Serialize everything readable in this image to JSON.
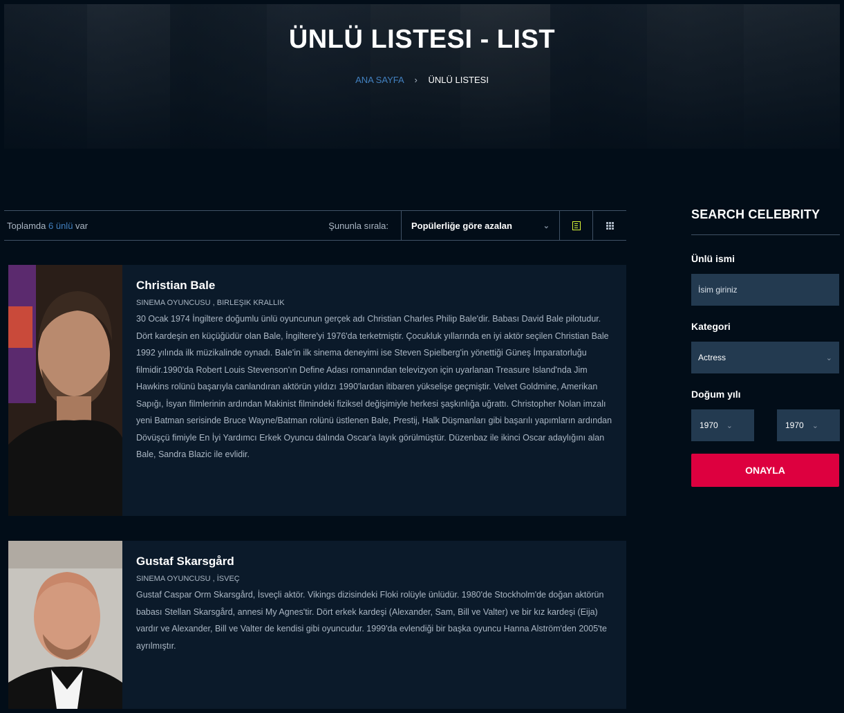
{
  "hero": {
    "title": "ÜNLÜ LISTESI - LIST",
    "breadcrumb": {
      "home": "ANA SAYFA",
      "separator": "›",
      "current": "ÜNLÜ LISTESI"
    }
  },
  "toolbar": {
    "total_prefix": "Toplamda",
    "total_count": "6 ünlü",
    "total_suffix": "var",
    "sort_label": "Şununla sırala:",
    "sort_value": "Popülerliğe göre azalan",
    "views": [
      "list-view",
      "grid-view"
    ]
  },
  "celebrities": [
    {
      "name": "Christian Bale",
      "meta": "SINEMA OYUNCUSU , BIRLEŞIK KRALLIK",
      "bio": "30 Ocak 1974 İngiltere doğumlu ünlü oyuncunun gerçek adı Christian Charles Philip Bale'dir. Babası David Bale pilotudur. Dört kardeşin en küçüğüdür olan Bale, İngiltere'yi 1976'da terketmiştir. Çocukluk yıllarında en iyi aktör seçilen Christian Bale 1992 yılında ilk müzikalinde oynadı. Bale'in ilk sinema deneyimi ise Steven Spielberg'in yönettiği Güneş İmparatorluğu filmidir.1990'da Robert Louis Stevenson'ın Define Adası romanından televizyon için uyarlanan Treasure Island'nda Jim Hawkins rolünü başarıyla canlandıran aktörün yıldızı 1990'lardan itibaren yükselişe geçmiştir. Velvet Goldmine, Amerikan Sapığı, İsyan filmlerinin ardından Makinist filmindeki fiziksel değişimiyle herkesi şaşkınlığa uğrattı. Christopher Nolan imzalı yeni Batman serisinde Bruce Wayne/Batman rolünü üstlenen Bale, Prestij, Halk Düşmanları gibi başarılı yapımların ardından Dövüşçü fimiyle En İyi Yardımcı Erkek Oyuncu dalında Oscar'a layık görülmüştür. Düzenbaz ile ikinci Oscar adaylığını alan Bale, Sandra Blazic ile evlidir."
    },
    {
      "name": "Gustaf Skarsgård",
      "meta": "SINEMA OYUNCUSU , İSVEÇ",
      "bio": "Gustaf Caspar Orm Skarsgård, İsveçli aktör. Vikings dizisindeki Floki rolüyle ünlüdür. 1980'de Stockholm'de doğan aktörün babası Stellan Skarsgård, annesi My Agnes'tir. Dört erkek kardeşi (Alexander, Sam, Bill ve Valter) ve bir kız kardeşi (Eija) vardır ve Alexander, Bill ve Valter de kendisi gibi oyuncudur. 1999'da evlendiği bir başka oyuncu Hanna Alström'den 2005'te ayrılmıştır."
    }
  ],
  "sidebar": {
    "title": "SEARCH CELEBRITY",
    "name_label": "Ünlü ismi",
    "name_placeholder": "İsim giriniz",
    "category_label": "Kategori",
    "category_value": "Actress",
    "birth_label": "Doğum yılı",
    "year_from": "1970",
    "year_to": "1970",
    "submit_label": "ONAYLA"
  },
  "colors": {
    "background": "#020d18",
    "card": "#0b1a2a",
    "accent_blue": "#4280bf",
    "accent_red": "#dd003f",
    "accent_yellow": "#dcf836",
    "input": "#233a50"
  }
}
